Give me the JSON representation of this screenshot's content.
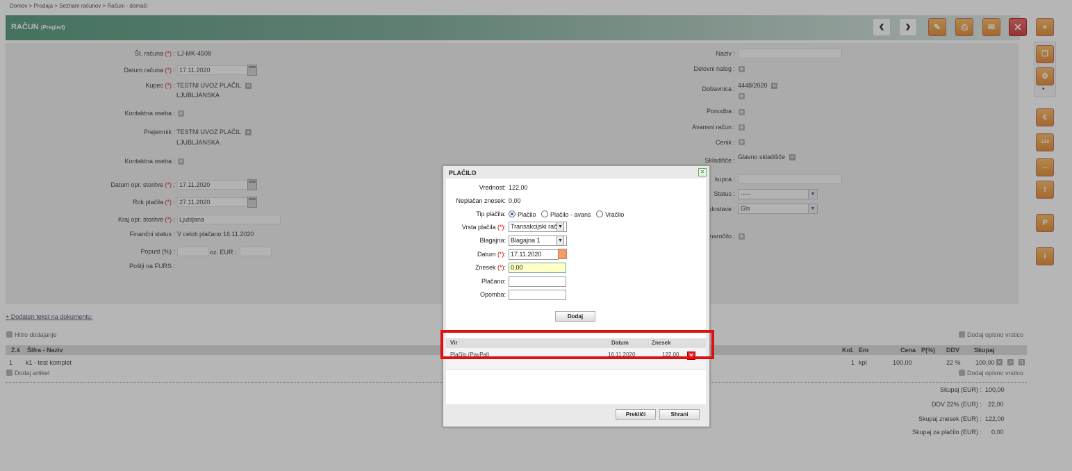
{
  "breadcrumb": [
    "Domov",
    ">",
    "Prodaja",
    ">",
    "Seznam računov",
    ">",
    "Računi - domači"
  ],
  "header": {
    "title": "RAČUN",
    "subtitle": "(Pregled)"
  },
  "form_left": {
    "st_racuna_label": "Št. računa",
    "st_racuna": "LJ-MK-4508",
    "datum_racuna_label": "Datum računa",
    "datum_racuna": "17.11.2020",
    "kupec_label": "Kupec",
    "kupec_line1": "TESTNI UVOZ PLAČIL",
    "kupec_line2": "LJUBLJANSKA",
    "kontaktna_label": "Kontaktna oseba :",
    "prejemnik_label": "Prejemnik :",
    "prejemnik_line1": "TESTNI UVOZ PLAČIL",
    "prejemnik_line2": "LJUBLJANSKA",
    "kontaktna2_label": "Kontaktna oseba :",
    "datum_opr_label": "Datum opr. storitve",
    "datum_opr": "17.11.2020",
    "rok_placila_label": "Rok plačila",
    "rok_placila": "27.11.2020",
    "kraj_label": "Kraj opr. storitve",
    "kraj": "Ljubljana",
    "financni_label": "Finančni status :",
    "financni": "V celoti plačano 16.11.2020",
    "popust_label": "Popust (%) :",
    "oz_eur_label": "oz. EUR :",
    "poslji_label": "Pošlji na FURS :"
  },
  "form_right": {
    "naziv_label": "Naziv :",
    "delovni_label": "Delovni nalog :",
    "dobavnica_label": "Dobavnica :",
    "dobavnica": "4448/2020",
    "ponudba_label": "Ponudba :",
    "avansni_label": "Avansni račun :",
    "cenik_label": "Cenik :",
    "skladisce_label": "Skladišče :",
    "skladisce": "Glavno skladišče",
    "kupca_label": "kupca :",
    "status_label": "Status :",
    "status": "-----",
    "dostave_label": "dostave :",
    "dostave": "Gls",
    "narocilo_label": "naročilo :"
  },
  "links": {
    "dodaten_tekst": "+ Dodaten tekst na dokumentu:",
    "hitro": "Hitro dodajanje",
    "opisno": "Dodaj opisno vrstico",
    "artikel": "Dodaj artikel",
    "opisno2": "Dodaj opisno vrstico"
  },
  "items_table": {
    "headers": {
      "zs": "Z.š",
      "sifra": "Šifra - Naziv",
      "kol": "Kol.",
      "em": "Em",
      "cena": "Cena",
      "p": "P(%)",
      "ddv": "DDV",
      "skupaj": "Skupaj"
    },
    "rows": [
      {
        "zs": "1",
        "sifra": "k1 - test komplet",
        "kol": "1",
        "em": "kpl",
        "cena": "100,00",
        "ddv": "22 %",
        "skupaj": "100,00"
      }
    ]
  },
  "totals": [
    {
      "label": "Skupaj (EUR) :",
      "value": "100,00"
    },
    {
      "label": "DDV 22% (EUR) :",
      "value": "22,00"
    },
    {
      "label": "Skupaj znesek (EUR) :",
      "value": "122,00"
    },
    {
      "label": "Skupaj za plačilo (EUR) :",
      "value": "0,00"
    }
  ],
  "dialog": {
    "title": "PLAČILO",
    "vrednost_label": "Vrednost:",
    "vrednost": "122,00",
    "neplacan_label": "Neplačan znesek:",
    "neplacan": "0,00",
    "tip_label": "Tip plačila:",
    "tip_options": [
      "Plačilo",
      "Plačilo - avans",
      "Vračilo"
    ],
    "vrsta_label": "Vrsta plačila",
    "vrsta": "Transakcijski rač",
    "blagajna_label": "Blagajna:",
    "blagajna": "Blagajna 1",
    "datum_label": "Datum",
    "datum": "17.11.2020",
    "znesek_label": "Znesek",
    "znesek": "0,00",
    "placano_label": "Plačano:",
    "opomba_label": "Opomba:",
    "dodaj": "Dodaj",
    "table_headers": {
      "vir": "Vir",
      "datum": "Datum",
      "znesek": "Znesek"
    },
    "payment": {
      "vir": "Plačilo (PayPal)",
      "datum": "16.11.2020",
      "znesek": "122,00"
    },
    "cancel": "Prekliči",
    "save": "Shrani"
  },
  "colors": {
    "header_green": "#3d8a6a",
    "highlight_red": "#e01010",
    "znesek_bg": "#ffffc8"
  }
}
